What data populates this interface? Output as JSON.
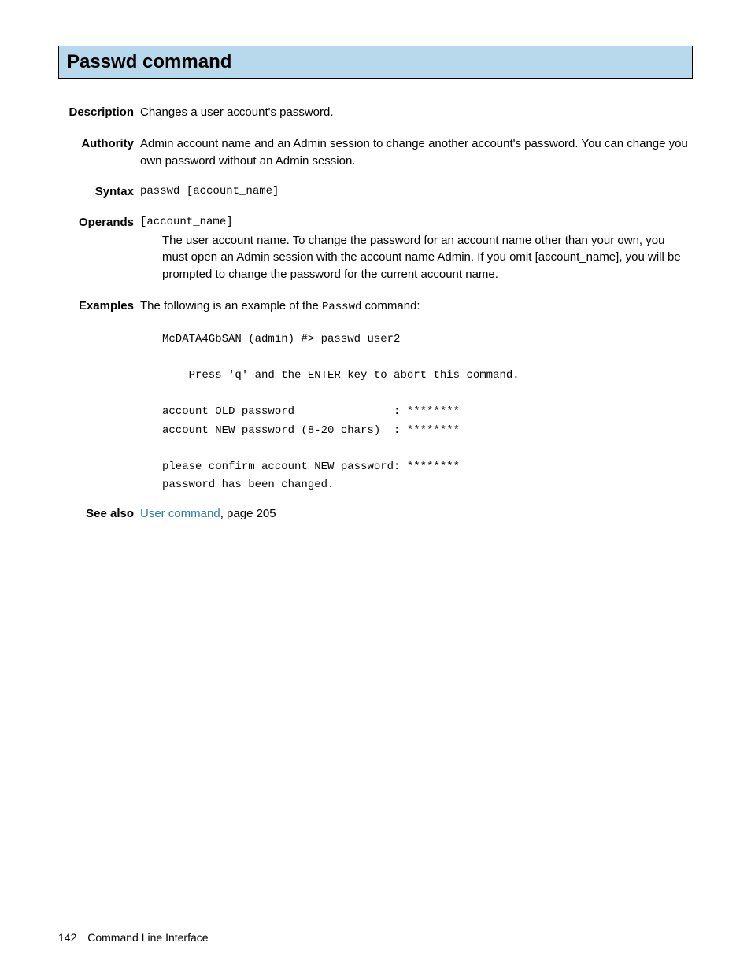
{
  "title": "Passwd command",
  "labels": {
    "description": "Description",
    "authority": "Authority",
    "syntax": "Syntax",
    "operands": "Operands",
    "examples": "Examples",
    "see_also": "See also"
  },
  "description": "Changes a user account's password.",
  "authority": "Admin account name and an Admin session to change another account's password. You can change you own password without an Admin session.",
  "syntax": "passwd [account_name]",
  "operand": {
    "name": "[account_name]",
    "desc": "The user account name. To change the password for an account name other than your own, you must open an Admin session with the account name Admin. If you omit [account_name], you will be prompted to change the password for the current account name."
  },
  "example": {
    "intro_pre": "The following is an example of the ",
    "intro_cmd": "Passwd",
    "intro_post": " command:",
    "block": "McDATA4GbSAN (admin) #> passwd user2\n\n    Press 'q' and the ENTER key to abort this command.\n\naccount OLD password               : ********\naccount NEW password (8-20 chars)  : ********\n\nplease confirm account NEW password: ********\npassword has been changed."
  },
  "see_also": {
    "link_text": "User command",
    "suffix": ", page 205"
  },
  "footer": {
    "page_number": "142",
    "section": "Command Line Interface"
  }
}
